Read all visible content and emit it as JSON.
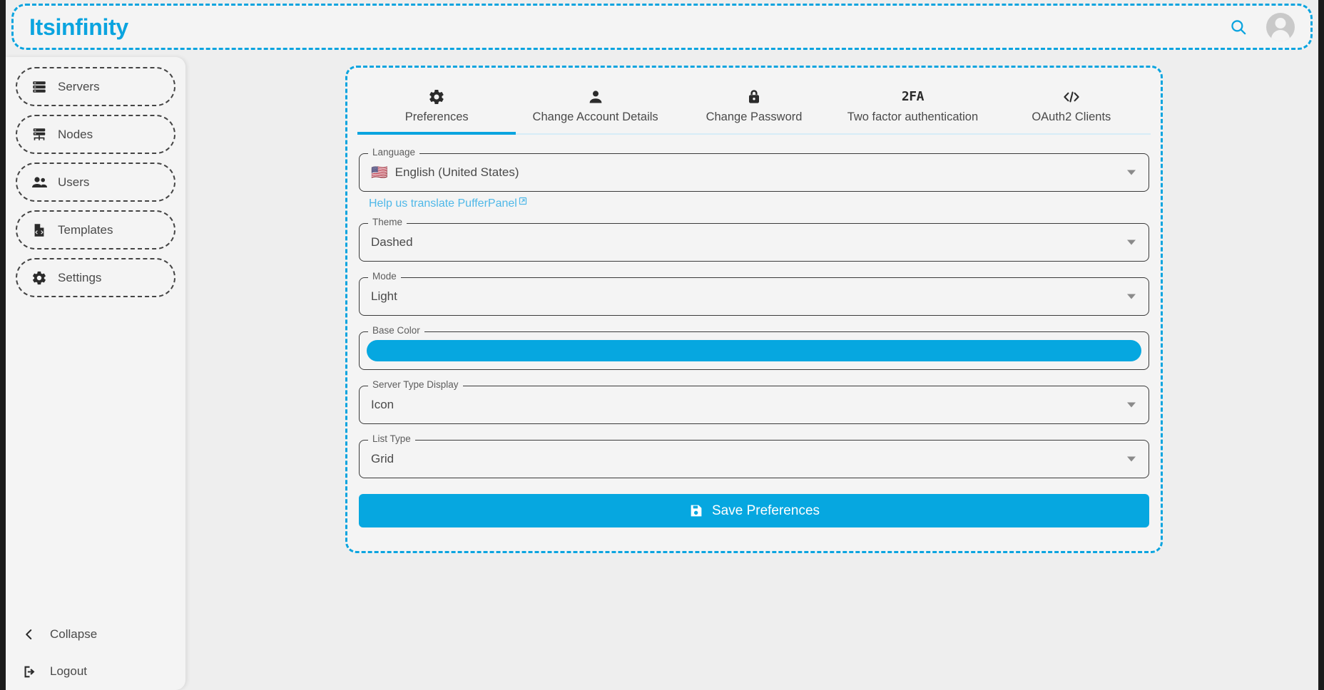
{
  "theme": {
    "accent": "#0ba4df",
    "accent_solid": "#06a7e0",
    "page_bg": "#eeeeee",
    "surface": "#f4f4f4",
    "text": "#4a4a4a"
  },
  "header": {
    "brand": "Itsinfinity",
    "search_icon": "search-icon",
    "avatar_icon": "account-avatar"
  },
  "sidebar": {
    "items": [
      {
        "label": "Servers",
        "icon": "storage-icon"
      },
      {
        "label": "Nodes",
        "icon": "hub-icon"
      },
      {
        "label": "Users",
        "icon": "people-icon"
      },
      {
        "label": "Templates",
        "icon": "code-file-icon"
      },
      {
        "label": "Settings",
        "icon": "gear-icon"
      }
    ],
    "collapse": {
      "label": "Collapse",
      "icon": "chevron-left-icon"
    },
    "logout": {
      "label": "Logout",
      "icon": "logout-icon"
    }
  },
  "main": {
    "tabs": [
      {
        "label": "Preferences",
        "icon": "gear-icon",
        "active": true
      },
      {
        "label": "Change Account Details",
        "icon": "person-icon",
        "active": false
      },
      {
        "label": "Change Password",
        "icon": "lock-icon",
        "active": false
      },
      {
        "label": "Two factor authentication",
        "icon": "2fa-glyph",
        "active": false,
        "glyph": "2FA"
      },
      {
        "label": "OAuth2 Clients",
        "icon": "code-icon",
        "active": false
      }
    ],
    "fields": {
      "language": {
        "legend": "Language",
        "value": "English (United States)",
        "flag": "🇺🇸"
      },
      "translate_link": {
        "label": "Help us translate PufferPanel",
        "icon": "external-link-icon"
      },
      "theme": {
        "legend": "Theme",
        "value": "Dashed"
      },
      "mode": {
        "legend": "Mode",
        "value": "Light"
      },
      "base_color": {
        "legend": "Base Color",
        "color": "#06a7e0"
      },
      "server_type_display": {
        "legend": "Server Type Display",
        "value": "Icon"
      },
      "list_type": {
        "legend": "List Type",
        "value": "Grid"
      }
    },
    "save_button": {
      "label": "Save Preferences",
      "icon": "save-icon"
    }
  }
}
